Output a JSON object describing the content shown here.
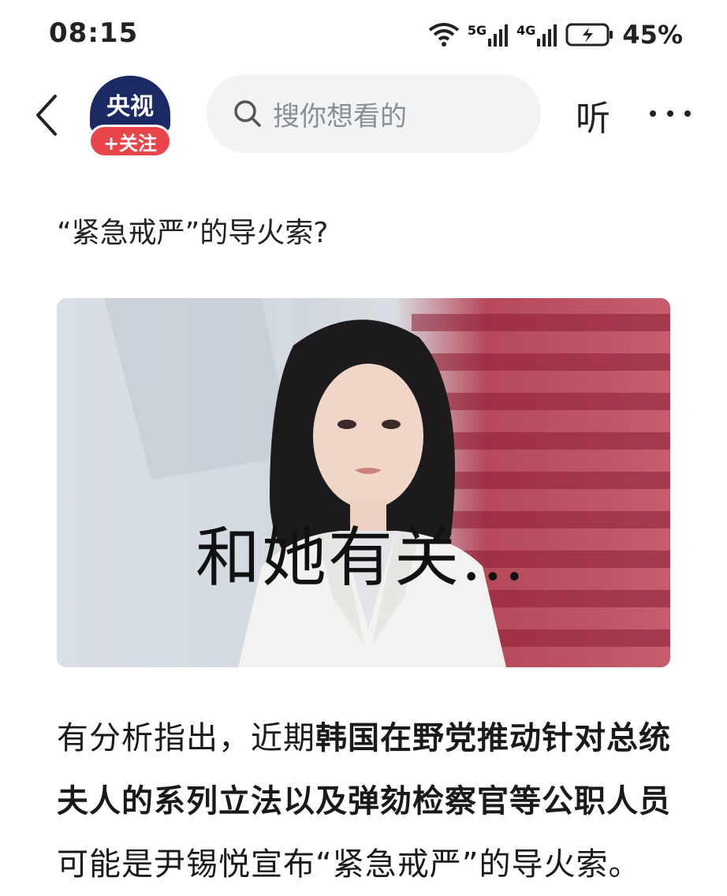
{
  "status_bar": {
    "time": "08:15",
    "network1": "5G",
    "network2": "4G",
    "battery_percent": "45%"
  },
  "nav": {
    "avatar_text": "央视",
    "follow_label": "+关注",
    "search_placeholder": "搜你想看的",
    "listen_label": "听"
  },
  "article": {
    "headline": "“紧急戒严”的导火索?",
    "image_caption": "和她有关…",
    "body_parts": [
      {
        "text": "有分析指出，近期",
        "bold": false
      },
      {
        "text": "韩国在野党推动针对总统夫人的系列立法以及弹劾检察官等公职人员",
        "bold": true
      },
      {
        "text": "可能是尹锡悦宣布“紧急戒严”的导火索。",
        "bold": false
      }
    ]
  },
  "colors": {
    "avatar_bg": "#1b2a63",
    "follow_bg": "#e8454b",
    "search_bg": "#f1f3f5"
  }
}
